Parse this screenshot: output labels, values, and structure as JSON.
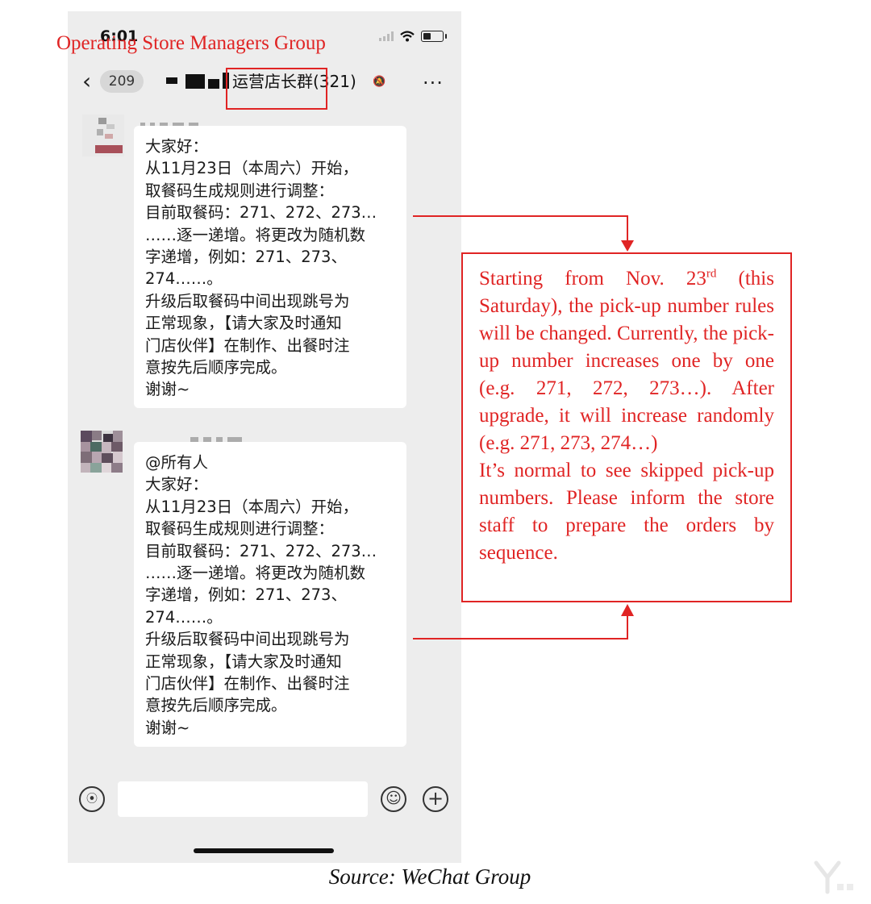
{
  "status_bar": {
    "time": "6:01"
  },
  "group_name_translation": "Operating Store Managers Group",
  "nav": {
    "back_glyph": "<",
    "unread_count": "209",
    "title": "运营店长群(321)",
    "more_glyph": "..."
  },
  "messages": [
    {
      "lines": [
        "大家好：",
        "从11月23日（本周六）开始，",
        "取餐码生成规则进行调整：",
        "目前取餐码：271、272、273…",
        "……逐一递增。将更改为随机数",
        "字递增，例如：271、273、",
        "274……。",
        "升级后取餐码中间出现跳号为",
        "正常现象，【请大家及时通知",
        "门店伙伴】在制作、出餐时注",
        "意按先后顺序完成。",
        "谢谢~"
      ]
    },
    {
      "lines": [
        "@所有人",
        "大家好：",
        "从11月23日（本周六）开始，",
        "取餐码生成规则进行调整：",
        "目前取餐码：271、272、273…",
        "……逐一递增。将更改为随机数",
        "字递增，例如：271、273、",
        "274……。",
        "升级后取餐码中间出现跳号为",
        "正常现象，【请大家及时通知",
        "门店伙伴】在制作、出餐时注",
        "意按先后顺序完成。",
        "谢谢~"
      ]
    }
  ],
  "input_bar": {
    "voice_icon": "voice-icon",
    "emoji_icon": "emoji-icon",
    "plus_icon": "plus-icon"
  },
  "annotation": {
    "para1_prefix": "Starting from Nov. 23",
    "para1_sup": "rd",
    "para1_suffix": " (this Saturday), the pick-up number rules will be changed. Currently, the pick-up number increases one by one (e.g. 271, 272, 273…). After upgrade, it will increase randomly (e.g. 271, 273, 274…)",
    "para2": "It’s normal to see skipped pick-up numbers. Please inform the store staff to prepare the orders by sequence."
  },
  "caption": "Source: WeChat Group",
  "colors": {
    "annotation_red": "#e02424",
    "chat_background": "#ededed",
    "bubble": "#ffffff"
  }
}
